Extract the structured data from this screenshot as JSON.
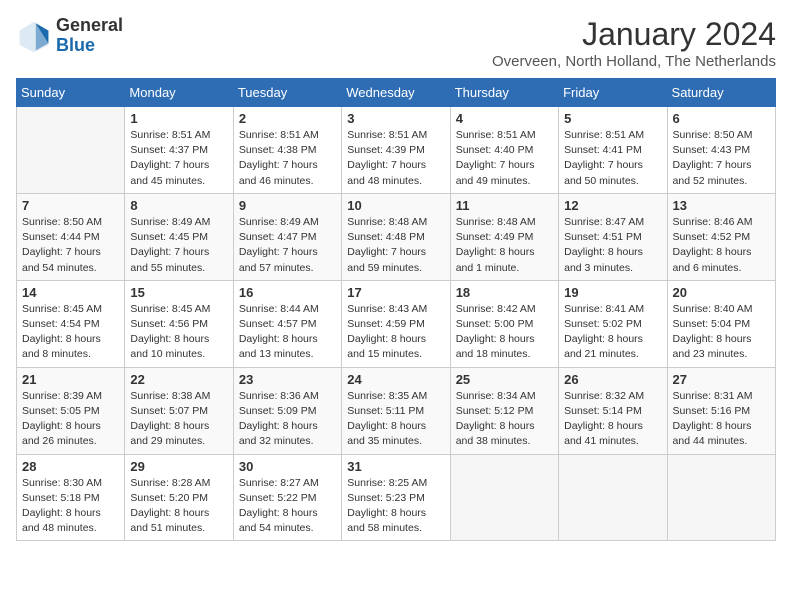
{
  "header": {
    "logo_general": "General",
    "logo_blue": "Blue",
    "month_title": "January 2024",
    "location": "Overveen, North Holland, The Netherlands"
  },
  "days_of_week": [
    "Sunday",
    "Monday",
    "Tuesday",
    "Wednesday",
    "Thursday",
    "Friday",
    "Saturday"
  ],
  "weeks": [
    [
      {
        "day": "",
        "sunrise": "",
        "sunset": "",
        "daylight": ""
      },
      {
        "day": "1",
        "sunrise": "Sunrise: 8:51 AM",
        "sunset": "Sunset: 4:37 PM",
        "daylight": "Daylight: 7 hours and 45 minutes."
      },
      {
        "day": "2",
        "sunrise": "Sunrise: 8:51 AM",
        "sunset": "Sunset: 4:38 PM",
        "daylight": "Daylight: 7 hours and 46 minutes."
      },
      {
        "day": "3",
        "sunrise": "Sunrise: 8:51 AM",
        "sunset": "Sunset: 4:39 PM",
        "daylight": "Daylight: 7 hours and 48 minutes."
      },
      {
        "day": "4",
        "sunrise": "Sunrise: 8:51 AM",
        "sunset": "Sunset: 4:40 PM",
        "daylight": "Daylight: 7 hours and 49 minutes."
      },
      {
        "day": "5",
        "sunrise": "Sunrise: 8:51 AM",
        "sunset": "Sunset: 4:41 PM",
        "daylight": "Daylight: 7 hours and 50 minutes."
      },
      {
        "day": "6",
        "sunrise": "Sunrise: 8:50 AM",
        "sunset": "Sunset: 4:43 PM",
        "daylight": "Daylight: 7 hours and 52 minutes."
      }
    ],
    [
      {
        "day": "7",
        "sunrise": "Sunrise: 8:50 AM",
        "sunset": "Sunset: 4:44 PM",
        "daylight": "Daylight: 7 hours and 54 minutes."
      },
      {
        "day": "8",
        "sunrise": "Sunrise: 8:49 AM",
        "sunset": "Sunset: 4:45 PM",
        "daylight": "Daylight: 7 hours and 55 minutes."
      },
      {
        "day": "9",
        "sunrise": "Sunrise: 8:49 AM",
        "sunset": "Sunset: 4:47 PM",
        "daylight": "Daylight: 7 hours and 57 minutes."
      },
      {
        "day": "10",
        "sunrise": "Sunrise: 8:48 AM",
        "sunset": "Sunset: 4:48 PM",
        "daylight": "Daylight: 7 hours and 59 minutes."
      },
      {
        "day": "11",
        "sunrise": "Sunrise: 8:48 AM",
        "sunset": "Sunset: 4:49 PM",
        "daylight": "Daylight: 8 hours and 1 minute."
      },
      {
        "day": "12",
        "sunrise": "Sunrise: 8:47 AM",
        "sunset": "Sunset: 4:51 PM",
        "daylight": "Daylight: 8 hours and 3 minutes."
      },
      {
        "day": "13",
        "sunrise": "Sunrise: 8:46 AM",
        "sunset": "Sunset: 4:52 PM",
        "daylight": "Daylight: 8 hours and 6 minutes."
      }
    ],
    [
      {
        "day": "14",
        "sunrise": "Sunrise: 8:45 AM",
        "sunset": "Sunset: 4:54 PM",
        "daylight": "Daylight: 8 hours and 8 minutes."
      },
      {
        "day": "15",
        "sunrise": "Sunrise: 8:45 AM",
        "sunset": "Sunset: 4:56 PM",
        "daylight": "Daylight: 8 hours and 10 minutes."
      },
      {
        "day": "16",
        "sunrise": "Sunrise: 8:44 AM",
        "sunset": "Sunset: 4:57 PM",
        "daylight": "Daylight: 8 hours and 13 minutes."
      },
      {
        "day": "17",
        "sunrise": "Sunrise: 8:43 AM",
        "sunset": "Sunset: 4:59 PM",
        "daylight": "Daylight: 8 hours and 15 minutes."
      },
      {
        "day": "18",
        "sunrise": "Sunrise: 8:42 AM",
        "sunset": "Sunset: 5:00 PM",
        "daylight": "Daylight: 8 hours and 18 minutes."
      },
      {
        "day": "19",
        "sunrise": "Sunrise: 8:41 AM",
        "sunset": "Sunset: 5:02 PM",
        "daylight": "Daylight: 8 hours and 21 minutes."
      },
      {
        "day": "20",
        "sunrise": "Sunrise: 8:40 AM",
        "sunset": "Sunset: 5:04 PM",
        "daylight": "Daylight: 8 hours and 23 minutes."
      }
    ],
    [
      {
        "day": "21",
        "sunrise": "Sunrise: 8:39 AM",
        "sunset": "Sunset: 5:05 PM",
        "daylight": "Daylight: 8 hours and 26 minutes."
      },
      {
        "day": "22",
        "sunrise": "Sunrise: 8:38 AM",
        "sunset": "Sunset: 5:07 PM",
        "daylight": "Daylight: 8 hours and 29 minutes."
      },
      {
        "day": "23",
        "sunrise": "Sunrise: 8:36 AM",
        "sunset": "Sunset: 5:09 PM",
        "daylight": "Daylight: 8 hours and 32 minutes."
      },
      {
        "day": "24",
        "sunrise": "Sunrise: 8:35 AM",
        "sunset": "Sunset: 5:11 PM",
        "daylight": "Daylight: 8 hours and 35 minutes."
      },
      {
        "day": "25",
        "sunrise": "Sunrise: 8:34 AM",
        "sunset": "Sunset: 5:12 PM",
        "daylight": "Daylight: 8 hours and 38 minutes."
      },
      {
        "day": "26",
        "sunrise": "Sunrise: 8:32 AM",
        "sunset": "Sunset: 5:14 PM",
        "daylight": "Daylight: 8 hours and 41 minutes."
      },
      {
        "day": "27",
        "sunrise": "Sunrise: 8:31 AM",
        "sunset": "Sunset: 5:16 PM",
        "daylight": "Daylight: 8 hours and 44 minutes."
      }
    ],
    [
      {
        "day": "28",
        "sunrise": "Sunrise: 8:30 AM",
        "sunset": "Sunset: 5:18 PM",
        "daylight": "Daylight: 8 hours and 48 minutes."
      },
      {
        "day": "29",
        "sunrise": "Sunrise: 8:28 AM",
        "sunset": "Sunset: 5:20 PM",
        "daylight": "Daylight: 8 hours and 51 minutes."
      },
      {
        "day": "30",
        "sunrise": "Sunrise: 8:27 AM",
        "sunset": "Sunset: 5:22 PM",
        "daylight": "Daylight: 8 hours and 54 minutes."
      },
      {
        "day": "31",
        "sunrise": "Sunrise: 8:25 AM",
        "sunset": "Sunset: 5:23 PM",
        "daylight": "Daylight: 8 hours and 58 minutes."
      },
      {
        "day": "",
        "sunrise": "",
        "sunset": "",
        "daylight": ""
      },
      {
        "day": "",
        "sunrise": "",
        "sunset": "",
        "daylight": ""
      },
      {
        "day": "",
        "sunrise": "",
        "sunset": "",
        "daylight": ""
      }
    ]
  ]
}
